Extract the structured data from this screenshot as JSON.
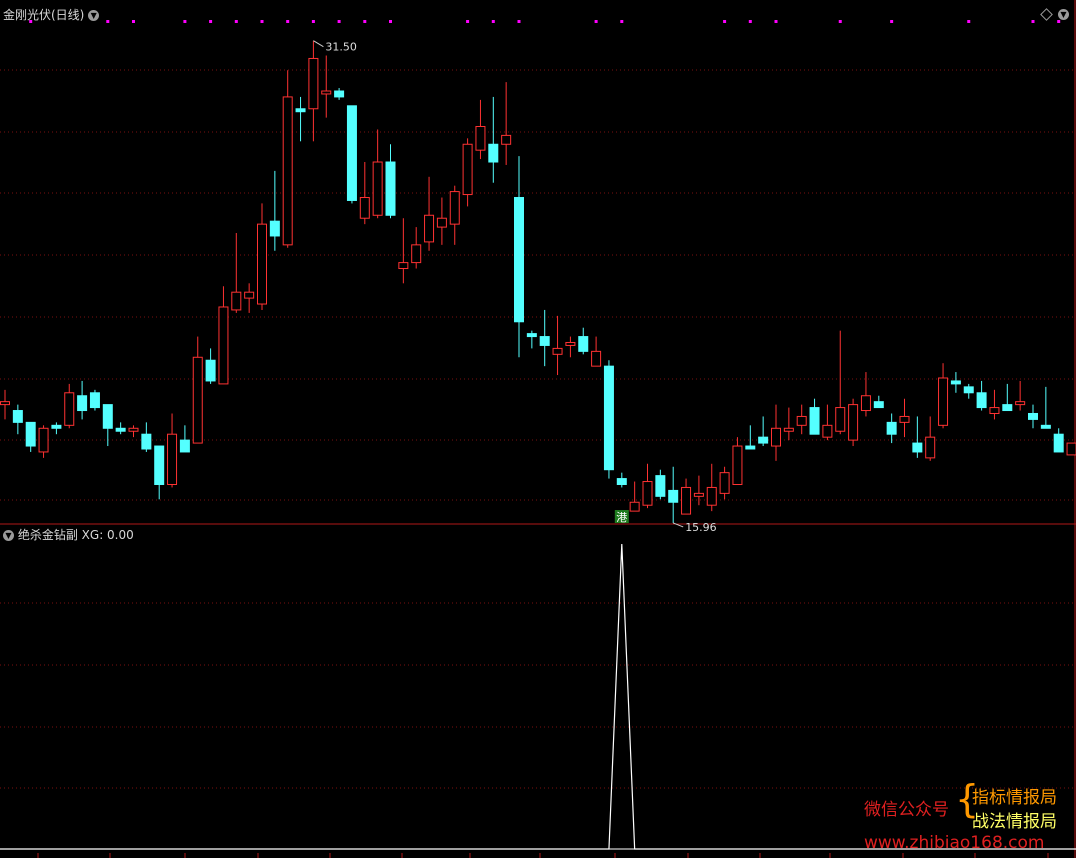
{
  "top_panel": {
    "title": "金刚光伏(日线)",
    "high_label": "31.50",
    "low_label": "15.96",
    "signal_label": "港"
  },
  "bottom_panel": {
    "title": "绝杀金钻副",
    "value_label": "XG: 0.00"
  },
  "watermark": {
    "account_prefix": "微信公众号",
    "line1": "指标情报局",
    "line2": "战法情报局",
    "url": "www.zhibiao168.com"
  },
  "colors": {
    "background": "#000000",
    "up": "#ff3232",
    "down": "#54ffff",
    "grid": "#7a1010",
    "divider": "#b01818",
    "marker": "#ff00ff",
    "indicator": "#ffffff",
    "watermark_red": "#e02020",
    "watermark_orange": "#ff9900",
    "watermark_yellow": "#ffff66"
  },
  "chart_data": [
    {
      "type": "candlestick",
      "title": "金刚光伏(日线)",
      "annotations": [
        {
          "label": "31.50",
          "kind": "high"
        },
        {
          "label": "15.96",
          "kind": "low"
        }
      ],
      "ohlc": [
        [
          19.2,
          19.7,
          18.7,
          19.3
        ],
        [
          19.0,
          19.2,
          18.2,
          18.6
        ],
        [
          18.6,
          18.6,
          17.6,
          17.8
        ],
        [
          17.6,
          18.5,
          17.4,
          18.4
        ],
        [
          18.5,
          18.6,
          18.2,
          18.4
        ],
        [
          18.5,
          19.9,
          18.4,
          19.6
        ],
        [
          19.5,
          20.0,
          18.7,
          19.0
        ],
        [
          19.6,
          19.7,
          19.0,
          19.1
        ],
        [
          19.2,
          19.2,
          17.8,
          18.4
        ],
        [
          18.4,
          18.6,
          18.2,
          18.3
        ],
        [
          18.3,
          18.5,
          18.1,
          18.4
        ],
        [
          18.2,
          18.6,
          17.6,
          17.7
        ],
        [
          17.8,
          17.8,
          16.0,
          16.5
        ],
        [
          16.5,
          18.9,
          16.4,
          18.2
        ],
        [
          18.0,
          18.5,
          17.8,
          17.6
        ],
        [
          17.9,
          21.5,
          17.9,
          20.8
        ],
        [
          20.7,
          21.1,
          19.9,
          20.0
        ],
        [
          19.9,
          23.2,
          19.9,
          22.5
        ],
        [
          22.4,
          25.0,
          22.3,
          23.0
        ],
        [
          22.8,
          23.3,
          22.3,
          23.0
        ],
        [
          22.6,
          26.0,
          22.4,
          25.3
        ],
        [
          25.4,
          27.1,
          24.4,
          24.9
        ],
        [
          24.6,
          30.5,
          24.5,
          29.6
        ],
        [
          29.2,
          29.6,
          28.1,
          29.1
        ],
        [
          29.2,
          31.5,
          28.1,
          30.9
        ],
        [
          29.7,
          31.0,
          28.9,
          29.8
        ],
        [
          29.8,
          29.9,
          29.5,
          29.6
        ],
        [
          29.3,
          29.3,
          26.0,
          26.1
        ],
        [
          25.5,
          27.4,
          25.3,
          26.2
        ],
        [
          25.6,
          28.5,
          25.5,
          27.4
        ],
        [
          27.4,
          28.0,
          25.5,
          25.6
        ],
        [
          23.8,
          25.5,
          23.3,
          24.0
        ],
        [
          24.0,
          25.2,
          23.8,
          24.6
        ],
        [
          24.7,
          26.9,
          24.4,
          25.6
        ],
        [
          25.2,
          26.2,
          24.6,
          25.5
        ],
        [
          25.3,
          26.6,
          24.6,
          26.4
        ],
        [
          26.3,
          28.2,
          25.9,
          28.0
        ],
        [
          27.8,
          29.5,
          27.5,
          28.6
        ],
        [
          28.0,
          29.6,
          26.7,
          27.4
        ],
        [
          28.0,
          30.1,
          27.3,
          28.3
        ],
        [
          26.2,
          27.6,
          20.8,
          22.0
        ],
        [
          21.6,
          21.7,
          21.1,
          21.5
        ],
        [
          21.5,
          22.4,
          20.5,
          21.2
        ],
        [
          20.9,
          22.2,
          20.2,
          21.1
        ],
        [
          21.2,
          21.5,
          20.8,
          21.3
        ],
        [
          21.5,
          21.8,
          20.9,
          21.0
        ],
        [
          20.5,
          21.5,
          20.6,
          21.0
        ],
        [
          20.5,
          20.7,
          16.7,
          17.0
        ],
        [
          16.7,
          16.9,
          16.4,
          16.5
        ],
        [
          15.6,
          16.6,
          15.7,
          15.9
        ],
        [
          15.8,
          17.2,
          15.7,
          16.6
        ],
        [
          16.8,
          17.0,
          16.0,
          16.1
        ],
        [
          16.3,
          17.1,
          15.2,
          15.9
        ],
        [
          15.5,
          16.7,
          15.5,
          16.4
        ],
        [
          16.1,
          16.8,
          15.8,
          16.2
        ],
        [
          15.8,
          17.2,
          15.6,
          16.4
        ],
        [
          16.2,
          17.1,
          16.0,
          16.9
        ],
        [
          16.5,
          18.1,
          16.5,
          17.8
        ],
        [
          17.8,
          18.5,
          17.8,
          17.7
        ],
        [
          18.1,
          18.8,
          17.8,
          17.9
        ],
        [
          17.8,
          19.2,
          17.3,
          18.4
        ],
        [
          18.3,
          19.1,
          18.0,
          18.4
        ],
        [
          18.5,
          19.2,
          18.2,
          18.8
        ],
        [
          19.1,
          19.4,
          18.5,
          18.2
        ],
        [
          18.1,
          19.2,
          18.0,
          18.5
        ],
        [
          18.3,
          21.7,
          18.2,
          19.1
        ],
        [
          18.0,
          19.4,
          17.8,
          19.2
        ],
        [
          19.0,
          20.3,
          18.8,
          19.5
        ],
        [
          19.3,
          19.5,
          19.2,
          19.1
        ],
        [
          18.6,
          18.9,
          17.9,
          18.2
        ],
        [
          18.6,
          19.4,
          18.1,
          18.8
        ],
        [
          17.9,
          18.8,
          17.4,
          17.6
        ],
        [
          17.4,
          18.8,
          17.3,
          18.1
        ],
        [
          18.5,
          20.6,
          18.4,
          20.1
        ],
        [
          20.0,
          20.3,
          19.6,
          19.9
        ],
        [
          19.8,
          19.9,
          19.4,
          19.6
        ],
        [
          19.6,
          20.0,
          19.0,
          19.1
        ],
        [
          18.9,
          19.7,
          18.7,
          19.1
        ],
        [
          19.2,
          19.9,
          19.0,
          19.0
        ],
        [
          19.2,
          20.0,
          19.0,
          19.3
        ],
        [
          18.9,
          19.2,
          18.4,
          18.7
        ],
        [
          18.5,
          19.8,
          18.5,
          18.4
        ],
        [
          18.2,
          18.4,
          17.6,
          17.6
        ],
        [
          17.5,
          17.9,
          17.6,
          17.9
        ],
        [
          17.8,
          18.6,
          17.4,
          18.2
        ],
        [
          18.1,
          18.3,
          17.3,
          16.8
        ],
        [
          16.6,
          16.8,
          16.5,
          16.7
        ],
        [
          16.7,
          17.4,
          16.0,
          16.4
        ],
        [
          16.0,
          16.8,
          16.3,
          16.9
        ]
      ],
      "markers": [
        2,
        8,
        10,
        14,
        16,
        18,
        20,
        22,
        24,
        26,
        28,
        30,
        36,
        38,
        40,
        46,
        48,
        56,
        58,
        60,
        65,
        69,
        75,
        80,
        82,
        88
      ],
      "signal_index": 48
    },
    {
      "type": "line",
      "title": "绝杀金钻副",
      "series": [
        {
          "name": "XG",
          "values": "zero except 1 at index 48"
        }
      ],
      "last_value": "0.00",
      "ylim": [
        0,
        1
      ]
    }
  ]
}
